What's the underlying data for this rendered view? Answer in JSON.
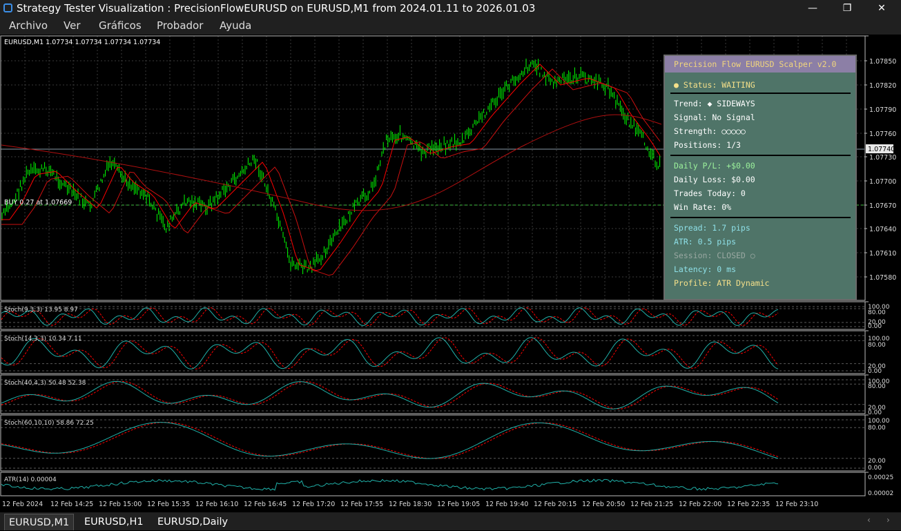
{
  "window": {
    "title": "Strategy Tester Visualization : PrecisionFlowEURUSD on EURUSD,M1 from 2024.01.11 to 2026.01.03",
    "controls": {
      "minimize": "—",
      "maximize": "❐",
      "close": "✕"
    }
  },
  "menu": [
    "Archivo",
    "Ver",
    "Gráficos",
    "Probador",
    "Ayuda"
  ],
  "chart": {
    "header": "EURUSD,M1  1.07734 1.07734 1.07734 1.07734",
    "price_axis": [
      "1.07850",
      "1.07820",
      "1.07790",
      "1.07760",
      "1.07730",
      "1.07700",
      "1.07670",
      "1.07640",
      "1.07610",
      "1.07580"
    ],
    "current_price": "1.07740",
    "order_label": "BUY 0.27 at 1.07669",
    "time_axis": [
      "12 Feb 2024",
      "12 Feb 14:25",
      "12 Feb 15:00",
      "12 Feb 15:35",
      "12 Feb 16:10",
      "12 Feb 16:45",
      "12 Feb 17:20",
      "12 Feb 17:55",
      "12 Feb 18:30",
      "12 Feb 19:05",
      "12 Feb 19:40",
      "12 Feb 20:15",
      "12 Feb 20:50",
      "12 Feb 21:25",
      "12 Feb 22:00",
      "12 Feb 22:35",
      "12 Feb 23:10"
    ],
    "colors": {
      "candle": "#00ff00",
      "ma": "#ff0000",
      "stoch_main": "#20b2aa",
      "stoch_signal": "#ff0000",
      "grid": "#3a3a3a"
    }
  },
  "subwindows": [
    {
      "label": "Stoch(9,3,3) 13.95 8.97",
      "levels": [
        "100.00",
        "80.00",
        "20.00",
        "0.00"
      ]
    },
    {
      "label": "Stoch(14,3,3) 10.34 7.11",
      "levels": [
        "100.00",
        "80.00",
        "20.00",
        "0.00"
      ]
    },
    {
      "label": "Stoch(40,4,3) 50.48 52.38",
      "levels": [
        "100.00",
        "80.00",
        "20.00",
        "0.00"
      ]
    },
    {
      "label": "Stoch(60,10,10) 58.86 72.25",
      "levels": [
        "100.00",
        "80.00",
        "20.00",
        "0.00"
      ]
    },
    {
      "label": "ATR(14) 0.00004",
      "levels": [
        "0.00025",
        "0.00002"
      ]
    }
  ],
  "panel": {
    "title": "Precision Flow EURUSD Scalper v2.0",
    "status": "● Status: WAITING",
    "trend": "Trend: ◆ SIDEWAYS",
    "signal": "Signal: No Signal",
    "strength": "Strength: ○○○○○",
    "positions": "Positions: 1/3",
    "daily_pl": "Daily P/L: +$0.00",
    "daily_loss": "Daily Loss: $0.00",
    "trades_today": "Trades Today: 0",
    "win_rate": "Win Rate: 0%",
    "spread": "Spread: 1.7 pips",
    "atr": "ATR: 0.5 pips",
    "session": "Session: CLOSED ○",
    "latency": "Latency: 0 ms",
    "profile": "Profile: ATR Dynamic",
    "colors": {
      "bg": "#4f7468",
      "header": "#8c7fa6",
      "status": "#f5e08a",
      "green": "#9cf29c",
      "cyan": "#8ee0e8",
      "grey": "#9aa8a2"
    }
  },
  "tabs": [
    "EURUSD,M1",
    "EURUSD,H1",
    "EURUSD,Daily"
  ]
}
